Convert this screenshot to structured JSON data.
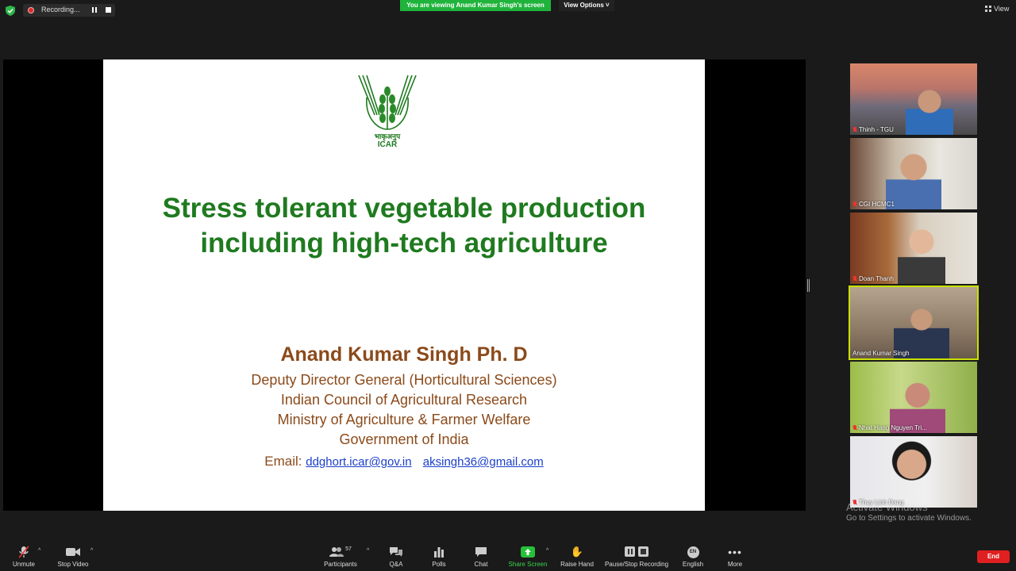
{
  "topbar": {
    "recording_label": "Recording...",
    "viewing_banner": "You are viewing Anand Kumar Singh's screen",
    "view_options": "View Options",
    "view_button": "View"
  },
  "slide": {
    "logo_text": "भाकृअनुप",
    "logo_caption": "ICAR",
    "title_line1": "Stress tolerant vegetable production",
    "title_line2": "including high-tech agriculture",
    "presenter": "Anand Kumar Singh Ph. D",
    "info": [
      "Deputy Director General (Horticultural Sciences)",
      "Indian Council of Agricultural Research",
      "Ministry of Agriculture & Farmer Welfare",
      "Government of India"
    ],
    "email_label": "Email:",
    "email1": "ddghort.icar@gov.in",
    "email2": "aksingh36@gmail.com"
  },
  "participants": [
    {
      "name": "Thinh - TGU"
    },
    {
      "name": "CGI HCMC1"
    },
    {
      "name": "Doan Thanh"
    },
    {
      "name": "Anand Kumar Singh"
    },
    {
      "name": "Nhat Hang Nguyen Tri..."
    },
    {
      "name": "Thuy Linh Dang"
    }
  ],
  "watermark": {
    "title": "Activate Windows",
    "subtitle": "Go to Settings to activate Windows."
  },
  "toolbar": {
    "unmute": "Unmute",
    "stop_video": "Stop Video",
    "participants": "Participants",
    "participant_count": "57",
    "qa": "Q&A",
    "polls": "Polls",
    "chat": "Chat",
    "share_screen": "Share Screen",
    "raise_hand": "Raise Hand",
    "pause_recording": "Pause/Stop Recording",
    "language": "English",
    "language_code": "EN",
    "more": "More",
    "end": "End"
  },
  "colors": {
    "banner_green": "#1fb33b",
    "slide_title_green": "#1f7a1f",
    "slide_text_brown": "#8b4a1a",
    "link_blue": "#1a3fc9",
    "end_red": "#e02020",
    "active_speaker": "#c8e000"
  }
}
